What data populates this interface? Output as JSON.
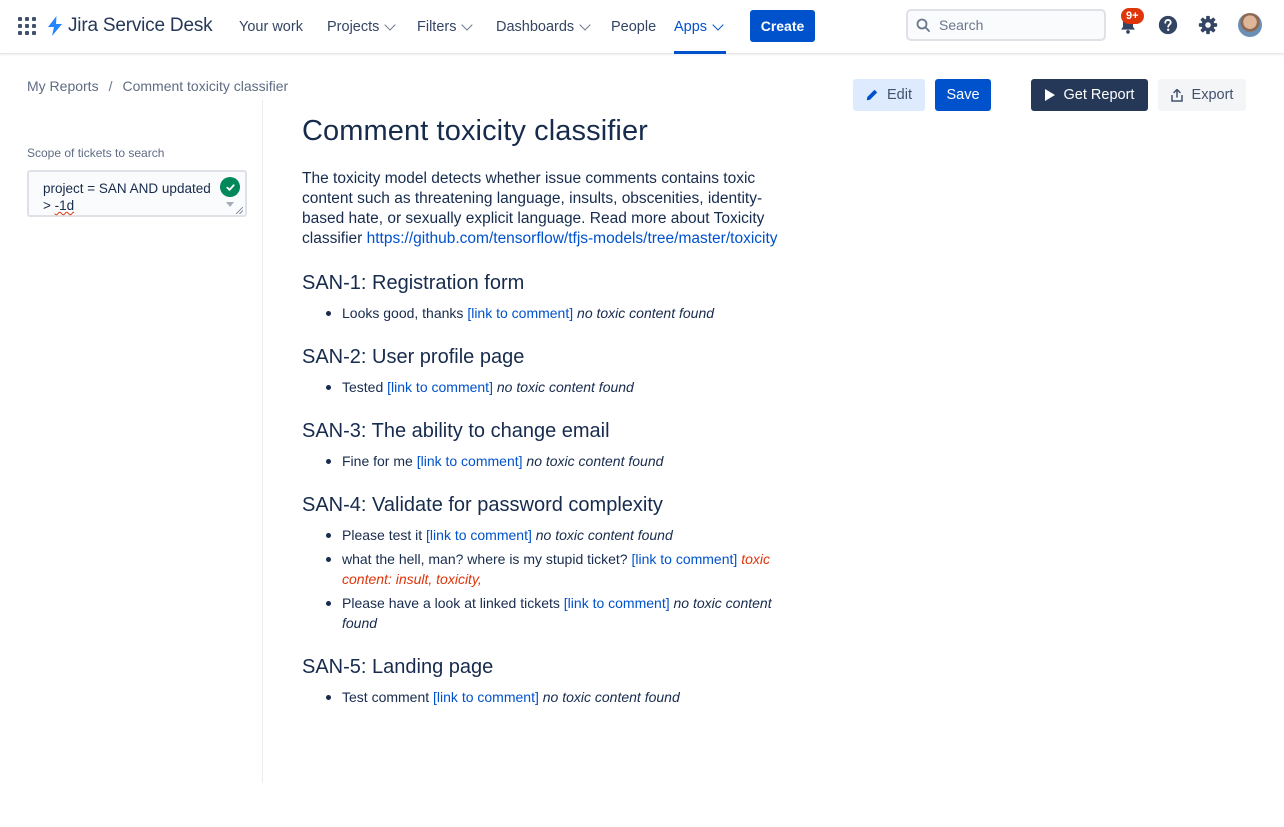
{
  "app": {
    "name": "Jira Service Desk"
  },
  "nav": {
    "your_work": "Your work",
    "projects": "Projects",
    "filters": "Filters",
    "dashboards": "Dashboards",
    "people": "People",
    "apps": "Apps",
    "create": "Create",
    "search_placeholder": "Search",
    "notifications_badge": "9+"
  },
  "breadcrumb": {
    "root": "My Reports",
    "separator": "/",
    "current": "Comment toxicity classifier"
  },
  "actions": {
    "edit": "Edit",
    "save": "Save",
    "get_report": "Get Report",
    "export": "Export"
  },
  "sidebar": {
    "scope_label": "Scope of tickets to search",
    "query_line1": "project = SAN AND updated",
    "query_line2_prefix": "> ",
    "query_line2_underlined": "-1d"
  },
  "main": {
    "title": "Comment toxicity classifier",
    "description": "The toxicity model detects whether issue comments contains toxic content such as threatening language, insults, obscenities, identity-based hate, or sexually explicit language. Read more about Toxicity classifier ",
    "link": "https://github.com/tensorflow/tfjs-models/tree/master/toxicity",
    "issues": [
      {
        "title": "SAN-1: Registration form",
        "comments": [
          {
            "text": "Looks good, thanks ",
            "link": "[link to comment]",
            "result": "no toxic content found"
          }
        ]
      },
      {
        "title": "SAN-2: User profile page",
        "comments": [
          {
            "text": "Tested ",
            "link": "[link to comment]",
            "result": "no toxic content found"
          }
        ]
      },
      {
        "title": "SAN-3: The ability to change email",
        "comments": [
          {
            "text": "Fine for me ",
            "link": "[link to comment]",
            "result": "no toxic content found"
          }
        ]
      },
      {
        "title": "SAN-4: Validate for password complexity",
        "comments": [
          {
            "text": "Please test it ",
            "link": "[link to comment]",
            "result": "no toxic content found"
          },
          {
            "text": "what the hell, man? where is my stupid ticket? ",
            "link": "[link to comment]",
            "result": "toxic content: insult, toxicity,"
          },
          {
            "text": "Please have a look at linked tickets ",
            "link": "[link to comment]",
            "result": "no toxic content found"
          }
        ]
      },
      {
        "title": "SAN-5: Landing page",
        "comments": [
          {
            "text": "Test comment ",
            "link": "[link to comment]",
            "result": "no toxic content found"
          }
        ]
      }
    ]
  },
  "colors": {
    "brand": "#0052cc",
    "toxic": "#de350b",
    "valid": "#00875a"
  }
}
